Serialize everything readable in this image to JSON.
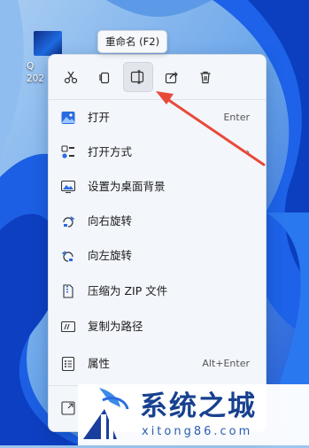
{
  "desktop": {
    "icon_label_line1": "Q",
    "icon_label_line2": "202"
  },
  "tooltip": "重命名 (F2)",
  "toolbar": [
    "cut-icon",
    "copy-icon",
    "rename-icon",
    "share-icon",
    "delete-icon"
  ],
  "menu": [
    {
      "label": "打开",
      "shortcut": "Enter",
      "icon": "image-icon"
    },
    {
      "label": "打开方式",
      "shortcut": "›",
      "icon": "open-with-icon"
    },
    {
      "label": "设置为桌面背景",
      "shortcut": "",
      "icon": "wallpaper-icon"
    },
    {
      "label": "向右旋转",
      "shortcut": "",
      "icon": "rotate-right-icon"
    },
    {
      "label": "向左旋转",
      "shortcut": "",
      "icon": "rotate-left-icon"
    },
    {
      "label": "压缩为 ZIP 文件",
      "shortcut": "",
      "icon": "zip-icon"
    },
    {
      "label": "复制为路径",
      "shortcut": "",
      "icon": "copy-path-icon"
    },
    {
      "label": "属性",
      "shortcut": "Alt+Enter",
      "icon": "properties-icon"
    }
  ],
  "watermark": {
    "title": "系统之城",
    "url": "xitong86.com"
  },
  "colors": {
    "accent": "#2b6be0",
    "arrow": "#e84a3a",
    "menu_bg": "#f3f6fb"
  }
}
